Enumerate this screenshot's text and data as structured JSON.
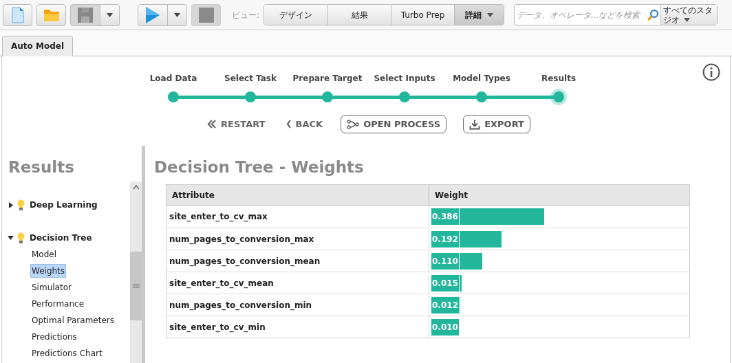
{
  "toolbar": {
    "view_label": "ビュー:",
    "views": [
      {
        "label": "デザイン",
        "selected": false
      },
      {
        "label": "結果",
        "selected": false
      },
      {
        "label": "Turbo Prep",
        "selected": false
      },
      {
        "label": "詳細",
        "selected": true
      }
    ],
    "search": {
      "placeholder": "データ、オペレータ...などを検索"
    },
    "studio_button": "すべてのスタジオ"
  },
  "tabs": [
    {
      "label": "Auto Model",
      "selected": true
    }
  ],
  "steps": [
    {
      "label": "Load Data",
      "selected": false
    },
    {
      "label": "Select Task",
      "selected": false
    },
    {
      "label": "Prepare Target",
      "selected": false
    },
    {
      "label": "Select Inputs",
      "selected": false
    },
    {
      "label": "Model Types",
      "selected": false
    },
    {
      "label": "Results",
      "selected": true
    }
  ],
  "actions": [
    {
      "label": "RESTART",
      "kind": "link"
    },
    {
      "label": "BACK",
      "kind": "link"
    },
    {
      "label": "OPEN PROCESS",
      "kind": "outlined"
    },
    {
      "label": "EXPORT",
      "kind": "outlined"
    }
  ],
  "sidebar": {
    "title": "Results",
    "tree": [
      {
        "label": "Deep Learning",
        "expanded": false
      },
      {
        "label": "Decision Tree",
        "expanded": true,
        "children": [
          {
            "label": "Model",
            "selected": false
          },
          {
            "label": "Weights",
            "selected": true
          },
          {
            "label": "Simulator",
            "selected": false
          },
          {
            "label": "Performance",
            "selected": false
          },
          {
            "label": "Optimal Parameters",
            "selected": false
          },
          {
            "label": "Predictions",
            "selected": false
          },
          {
            "label": "Predictions Chart",
            "selected": false
          }
        ]
      }
    ]
  },
  "main": {
    "title": "Decision Tree - Weights",
    "table": {
      "columns": [
        "Attribute",
        "Weight"
      ],
      "rows": [
        {
          "attribute": "site_enter_to_cv_max",
          "weight": "0.386",
          "level": 0.44
        },
        {
          "attribute": "num_pages_to_conversion_max",
          "weight": "0.192",
          "level": 0.275
        },
        {
          "attribute": "num_pages_to_conversion_mean",
          "weight": "0.110",
          "level": 0.2
        },
        {
          "attribute": "site_enter_to_cv_mean",
          "weight": "0.015",
          "level": 0.117
        },
        {
          "attribute": "num_pages_to_conversion_min",
          "weight": "0.012",
          "level": 0.114
        },
        {
          "attribute": "site_enter_to_cv_min",
          "weight": "0.010",
          "level": 0.111
        }
      ]
    }
  }
}
